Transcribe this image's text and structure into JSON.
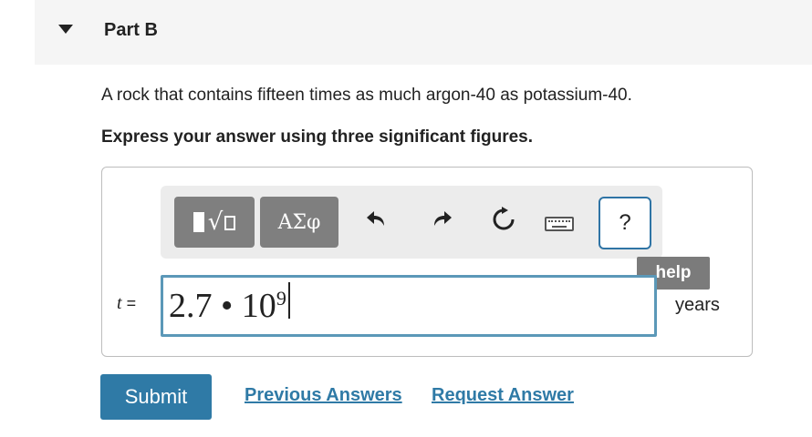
{
  "part": {
    "title": "Part B"
  },
  "question": {
    "text": "A rock that contains fifteen times as much argon-40 as potassium-40."
  },
  "instruction": {
    "text": "Express your answer using three significant figures."
  },
  "toolbar": {
    "templates_icon": "templates-icon",
    "symbols_label": "ΑΣφ",
    "undo_icon": "undo-icon",
    "redo_icon": "redo-icon",
    "reset_icon": "reset-icon",
    "keyboard_icon": "keyboard-icon",
    "help_label": "?"
  },
  "tooltip": {
    "text": "help"
  },
  "answer": {
    "variable": "t",
    "equals": "=",
    "base": "2.7 • 10",
    "exponent": "9",
    "units": "years"
  },
  "actions": {
    "submit": "Submit",
    "previous_answers": "Previous Answers",
    "request_answer": "Request Answer"
  },
  "colors": {
    "accent": "#2f7aa6",
    "input_border": "#5b98b8",
    "toolbar_bg": "#ececec",
    "toolbar_button": "#7f7f7f"
  }
}
